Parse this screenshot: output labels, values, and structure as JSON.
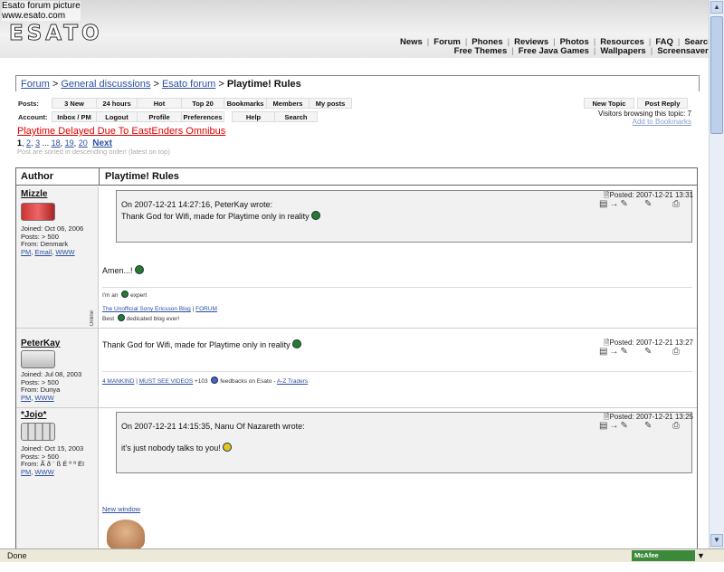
{
  "header": {
    "caption_line1": "Esato forum picture",
    "caption_line2": "www.esato.com",
    "logo": "ESATO",
    "nav_row1": [
      "News",
      "Forum",
      "Phones",
      "Reviews",
      "Photos",
      "Resources",
      "FAQ",
      "Search"
    ],
    "nav_row2": [
      "Free Themes",
      "Free Java Games",
      "Wallpapers",
      "Screensavers"
    ]
  },
  "breadcrumb": {
    "items": [
      "Forum",
      "General discussions",
      "Esato forum"
    ],
    "sep": ">",
    "current": "Playtime! Rules"
  },
  "toolbar": {
    "posts_label": "Posts:",
    "account_label": "Account:",
    "posts_buttons": [
      "3 New",
      "24 hours",
      "Hot",
      "Top 20",
      "Bookmarks",
      "Members",
      "My posts"
    ],
    "account_buttons": [
      "Inbox / PM",
      "Logout",
      "Profile",
      "Preferences",
      "Help",
      "Search"
    ],
    "new_topic": "New Topic",
    "post_reply": "Post Reply",
    "visitors": "Visitors browsing this topic: 7",
    "add_bookmarks": "Add to Bookmarks"
  },
  "topic": {
    "related_link": "Playtime Delayed Due To EastEnders Omnibus",
    "pages": [
      "1",
      "2",
      "3",
      "...",
      "18",
      "19",
      "20"
    ],
    "next": "Next",
    "sort_note": "Post are sorted in descending order! (latest on top)"
  },
  "table": {
    "author_header": "Author",
    "title_header": "Playtime! Rules"
  },
  "posts": [
    {
      "user": "Mizzle",
      "joined": "Joined: Oct 06, 2006",
      "posts": "Posts: > 500",
      "from": "From: Denmark",
      "links": [
        "PM",
        "Email",
        "WWW"
      ],
      "posted": "Posted: 2007-12-21 13:31",
      "quote_head": "On 2007-12-21 14:27:16, PeterKay wrote:",
      "quote_text": "Thank God for Wifi, made for Playtime only in reality",
      "body": "Amen...!",
      "sig1": "I'm an",
      "sig1b": "expert",
      "sig2_link": "The Unofficial Sony Ericsson Blog",
      "sig2_sep": "|",
      "sig2_link2": "FORUM",
      "sig3": "Best",
      "sig3b": "dedicated blog ever!",
      "online": "Online"
    },
    {
      "user": "PeterKay",
      "joined": "Joined: Jul 08, 2003",
      "posts": "Posts: > 500",
      "from": "From: Dunya",
      "links": [
        "PM",
        "WWW"
      ],
      "posted": "Posted: 2007-12-21 13:27",
      "body": "Thank God for Wifi, made for Playtime only in reality",
      "sig_link1": "4 MANKIND",
      "sig_link2": "MUST SEE VIDEOS",
      "sig_count": "+103",
      "sig_text": "feedbacks on Esato -",
      "sig_link3": "A-Z Traders"
    },
    {
      "user": "*Jojo*",
      "joined": "Joined: Oct 15, 2003",
      "posts": "Posts: > 500",
      "from": "From: Ã ð ¨ ß É º ª Ëï",
      "links": [
        "PM",
        "WWW"
      ],
      "posted": "Posted: 2007-12-21 13:25",
      "quote_head": "On 2007-12-21 14:15:35, Nanu Of Nazareth wrote:",
      "quote_text": "it's just nobody talks to you!",
      "new_window": "New window"
    }
  ],
  "status": {
    "text": "Done",
    "mcafee": "McAfee SiteAdvisor"
  }
}
